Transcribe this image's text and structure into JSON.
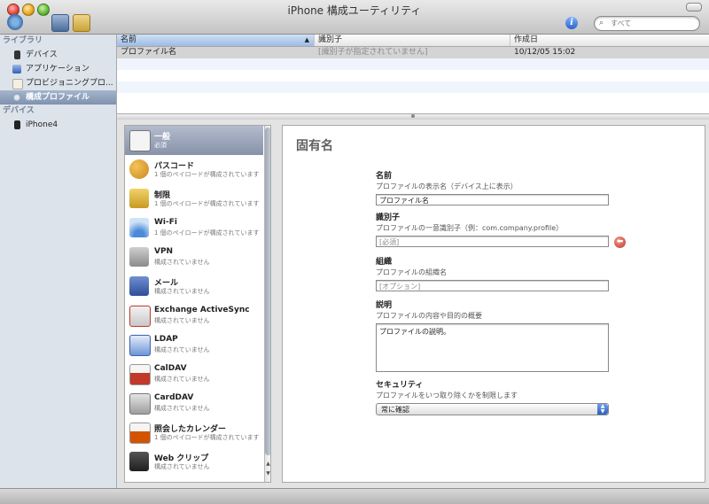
{
  "window": {
    "title": "iPhone 構成ユーティリティ"
  },
  "search": {
    "placeholder": "すべて"
  },
  "sidebar": {
    "library_header": "ライブラリ",
    "library_items": [
      {
        "label": "デバイス",
        "icon": "device-icon"
      },
      {
        "label": "アプリケーション",
        "icon": "app-icon"
      },
      {
        "label": "プロビジョニングプロ...",
        "icon": "provisioning-icon"
      },
      {
        "label": "構成プロファイル",
        "icon": "gear-icon",
        "selected": true
      }
    ],
    "devices_header": "デバイス",
    "device_items": [
      {
        "label": "iPhone4",
        "icon": "iphone-icon"
      }
    ]
  },
  "table": {
    "columns": [
      "名前",
      "識別子",
      "作成日"
    ],
    "rows": [
      {
        "name": "プロファイル名",
        "identifier": "[識別子が指定されていません]",
        "created": "10/12/05 15:02"
      }
    ]
  },
  "payloads": [
    {
      "title": "一般",
      "subtitle": "必須",
      "icon": "general-icon",
      "selected": true
    },
    {
      "title": "パスコード",
      "subtitle": "1 個のペイロードが構成されています",
      "icon": "key-icon"
    },
    {
      "title": "制限",
      "subtitle": "1 個のペイロードが構成されています",
      "icon": "lock-icon"
    },
    {
      "title": "Wi-Fi",
      "subtitle": "1 個のペイロードが構成されています",
      "icon": "wifi-icon"
    },
    {
      "title": "VPN",
      "subtitle": "構成されていません",
      "icon": "vpn-icon"
    },
    {
      "title": "メール",
      "subtitle": "構成されていません",
      "icon": "mail-icon"
    },
    {
      "title": "Exchange ActiveSync",
      "subtitle": "構成されていません",
      "icon": "exchange-icon"
    },
    {
      "title": "LDAP",
      "subtitle": "構成されていません",
      "icon": "ldap-icon"
    },
    {
      "title": "CalDAV",
      "subtitle": "構成されていません",
      "icon": "caldav-icon"
    },
    {
      "title": "CardDAV",
      "subtitle": "構成されていません",
      "icon": "carddav-icon"
    },
    {
      "title": "照会したカレンダー",
      "subtitle": "1 個のペイロードが構成されています",
      "icon": "subscribed-calendar-icon"
    },
    {
      "title": "Web クリップ",
      "subtitle": "構成されていません",
      "icon": "webclip-icon"
    }
  ],
  "detail": {
    "title": "固有名",
    "fields": {
      "name": {
        "label": "名前",
        "desc": "プロファイルの表示名（デバイス上に表示）",
        "value": "プロファイル名"
      },
      "identifier": {
        "label": "識別子",
        "desc": "プロファイルの一意識別子（例：com.company.profile）",
        "placeholder": "[必須]"
      },
      "organization": {
        "label": "組織",
        "desc": "プロファイルの組織名",
        "placeholder": "[オプション]"
      },
      "description": {
        "label": "説明",
        "desc": "プロファイルの内容や目的の概要",
        "value": "プロファイルの説明。"
      },
      "security": {
        "label": "セキュリティ",
        "desc": "プロファイルをいつ取り除くかを制限します",
        "value": "常に確認"
      }
    }
  }
}
